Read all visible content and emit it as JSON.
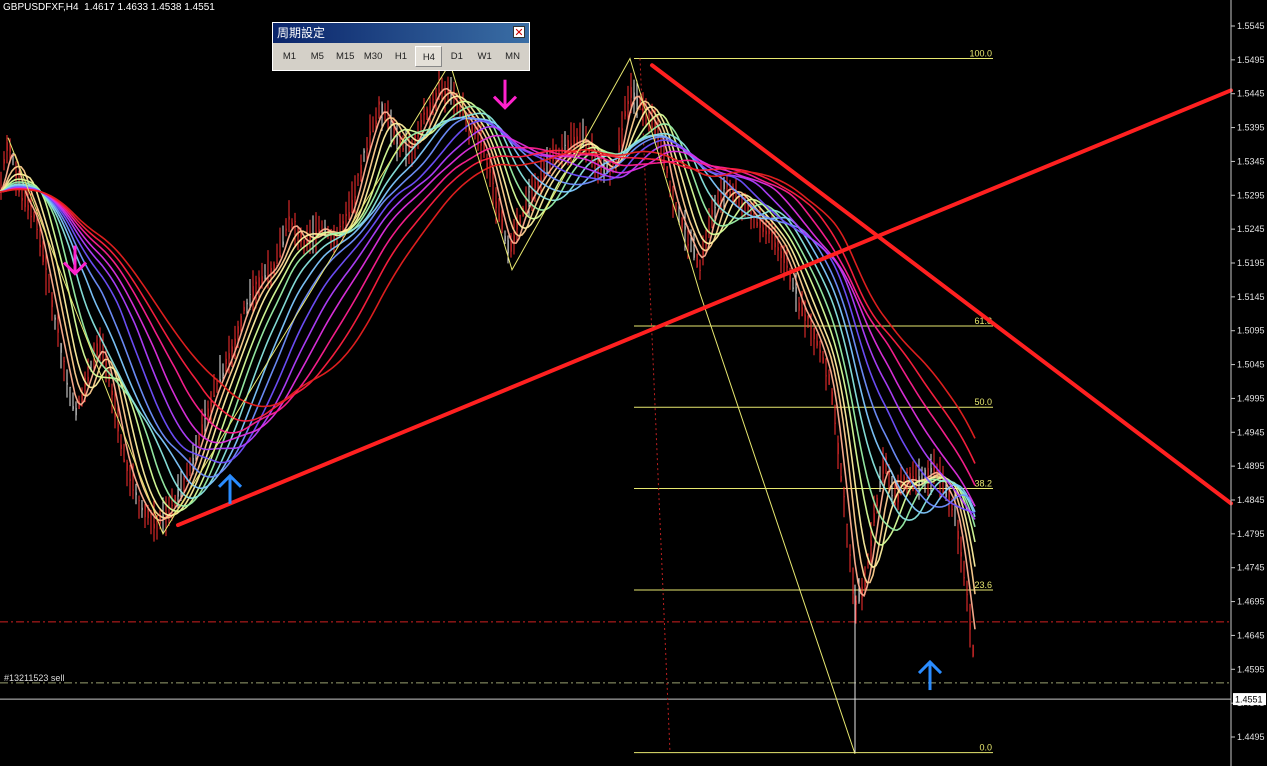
{
  "header": {
    "symbol": "GBPUSDFXF,H4",
    "ohlc": "1.4617 1.4633 1.4538 1.4551"
  },
  "timeframe_panel": {
    "title": "周期設定",
    "buttons": [
      "M1",
      "M5",
      "M15",
      "M30",
      "H1",
      "H4",
      "D1",
      "W1",
      "MN"
    ],
    "active": "H4"
  },
  "order_label": "#13211523 sell",
  "current_price": "1.4551",
  "colors": {
    "trendline": "#ff2020",
    "fib": "#e8e870",
    "arrow_up": "#2a8cff",
    "arrow_down": "#ff22cc",
    "candle": "#ff3030",
    "background": "#000000"
  },
  "chart_data": {
    "type": "line",
    "ylim": [
      1.445,
      1.5575
    ],
    "y_ticks": [
      "1.5545",
      "1.5495",
      "1.5445",
      "1.5395",
      "1.5345",
      "1.5295",
      "1.5245",
      "1.5195",
      "1.5145",
      "1.5095",
      "1.5045",
      "1.4995",
      "1.4945",
      "1.4895",
      "1.4845",
      "1.4795",
      "1.4745",
      "1.4695",
      "1.4645",
      "1.4595",
      "1.4545",
      "1.4495"
    ],
    "fib_levels": [
      {
        "label": "100.0",
        "price": 1.5497
      },
      {
        "label": "61.8",
        "price": 1.5102
      },
      {
        "label": "50.0",
        "price": 1.4982
      },
      {
        "label": "38.2",
        "price": 1.4862
      },
      {
        "label": "23.6",
        "price": 1.4712
      },
      {
        "label": "0.0",
        "price": 1.4472
      }
    ],
    "price_path": [
      [
        0,
        1.53
      ],
      [
        8,
        1.538
      ],
      [
        20,
        1.53
      ],
      [
        35,
        1.526
      ],
      [
        50,
        1.515
      ],
      [
        62,
        1.506
      ],
      [
        75,
        1.497
      ],
      [
        88,
        1.503
      ],
      [
        100,
        1.508
      ],
      [
        112,
        1.5
      ],
      [
        125,
        1.49
      ],
      [
        140,
        1.484
      ],
      [
        155,
        1.481
      ],
      [
        170,
        1.483
      ],
      [
        185,
        1.487
      ],
      [
        200,
        1.494
      ],
      [
        215,
        1.501
      ],
      [
        230,
        1.506
      ],
      [
        245,
        1.513
      ],
      [
        260,
        1.517
      ],
      [
        275,
        1.519
      ],
      [
        290,
        1.526
      ],
      [
        305,
        1.522
      ],
      [
        320,
        1.525
      ],
      [
        335,
        1.523
      ],
      [
        350,
        1.527
      ],
      [
        365,
        1.536
      ],
      [
        380,
        1.543
      ],
      [
        395,
        1.538
      ],
      [
        410,
        1.536
      ],
      [
        425,
        1.541
      ],
      [
        440,
        1.546
      ],
      [
        455,
        1.543
      ],
      [
        470,
        1.54
      ],
      [
        485,
        1.536
      ],
      [
        500,
        1.526
      ],
      [
        510,
        1.521
      ],
      [
        525,
        1.528
      ],
      [
        540,
        1.532
      ],
      [
        555,
        1.535
      ],
      [
        570,
        1.537
      ],
      [
        585,
        1.538
      ],
      [
        600,
        1.533
      ],
      [
        615,
        1.534
      ],
      [
        630,
        1.545
      ],
      [
        645,
        1.542
      ],
      [
        660,
        1.538
      ],
      [
        672,
        1.529
      ],
      [
        685,
        1.524
      ],
      [
        700,
        1.519
      ],
      [
        712,
        1.527
      ],
      [
        725,
        1.531
      ],
      [
        740,
        1.529
      ],
      [
        755,
        1.526
      ],
      [
        770,
        1.524
      ],
      [
        785,
        1.52
      ],
      [
        800,
        1.513
      ],
      [
        815,
        1.509
      ],
      [
        830,
        1.502
      ],
      [
        842,
        1.487
      ],
      [
        855,
        1.469
      ],
      [
        865,
        1.472
      ],
      [
        875,
        1.483
      ],
      [
        885,
        1.491
      ],
      [
        895,
        1.484
      ],
      [
        905,
        1.488
      ],
      [
        915,
        1.487
      ],
      [
        925,
        1.488
      ],
      [
        935,
        1.489
      ],
      [
        945,
        1.486
      ],
      [
        955,
        1.483
      ],
      [
        965,
        1.472
      ],
      [
        975,
        1.46
      ]
    ],
    "trendlines": [
      {
        "from": [
          178,
          1.4808
        ],
        "to": [
          1231,
          1.545
        ]
      },
      {
        "from": [
          652,
          1.5487
        ],
        "to": [
          1231,
          1.484
        ]
      }
    ],
    "zigzag": [
      [
        8,
        1.538
      ],
      [
        163,
        1.4795
      ],
      [
        450,
        1.549
      ],
      [
        512,
        1.5185
      ],
      [
        630,
        1.5497
      ],
      [
        700,
        1.515
      ],
      [
        855,
        1.447
      ]
    ],
    "hlines": [
      {
        "price": 1.4665,
        "style": "dashdot",
        "color": "#d02020"
      },
      {
        "price": 1.4575,
        "style": "dashdot",
        "color": "#9aa070"
      },
      {
        "price": 1.4551,
        "style": "solid",
        "color": "#c8c8c8"
      }
    ],
    "arrows": [
      {
        "x": 230,
        "price": 1.486,
        "dir": "up"
      },
      {
        "x": 930,
        "price": 1.4585,
        "dir": "up"
      },
      {
        "x": 75,
        "price": 1.52,
        "dir": "down"
      },
      {
        "x": 505,
        "price": 1.5445,
        "dir": "down"
      }
    ],
    "grid": false
  }
}
